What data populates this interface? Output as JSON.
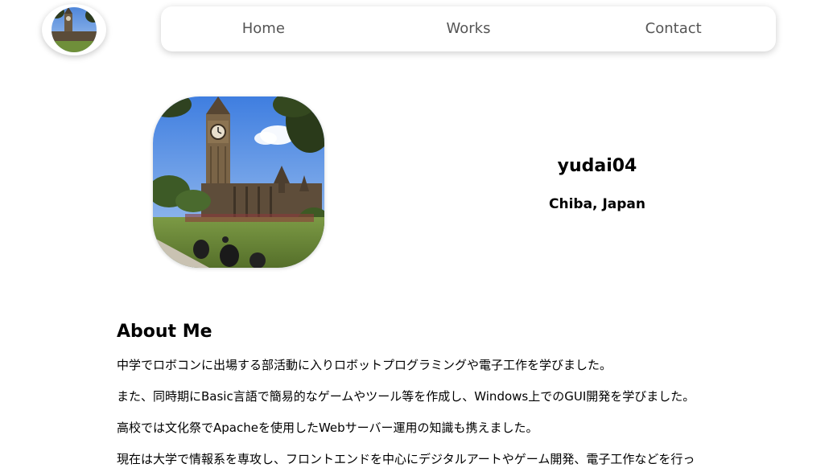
{
  "nav": {
    "links": [
      {
        "label": "Home"
      },
      {
        "label": "Works"
      },
      {
        "label": "Contact"
      }
    ]
  },
  "profile": {
    "name": "yudai04",
    "location": "Chiba, Japan"
  },
  "about": {
    "title": "About Me",
    "paragraphs": [
      "中学でロボコンに出場する部活動に入りロボットプログラミングや電子工作を学びました。",
      "また、同時期にBasic言語で簡易的なゲームやツール等を作成し、Windows上でのGUI開発を学びました。",
      "高校では文化祭でApacheを使用したWebサーバー運用の知識も携えました。",
      "現在は大学で情報系を専攻し、フロントエンドを中心にデジタルアートやゲーム開発、電子工作などを行っ"
    ]
  },
  "colors": {
    "nav_text": "#555555",
    "background": "#ffffff",
    "sky": "#7fb3ee",
    "grass": "#6a8f3a"
  },
  "icons": {
    "logo": "big-ben-photo",
    "avatar": "big-ben-photo"
  }
}
